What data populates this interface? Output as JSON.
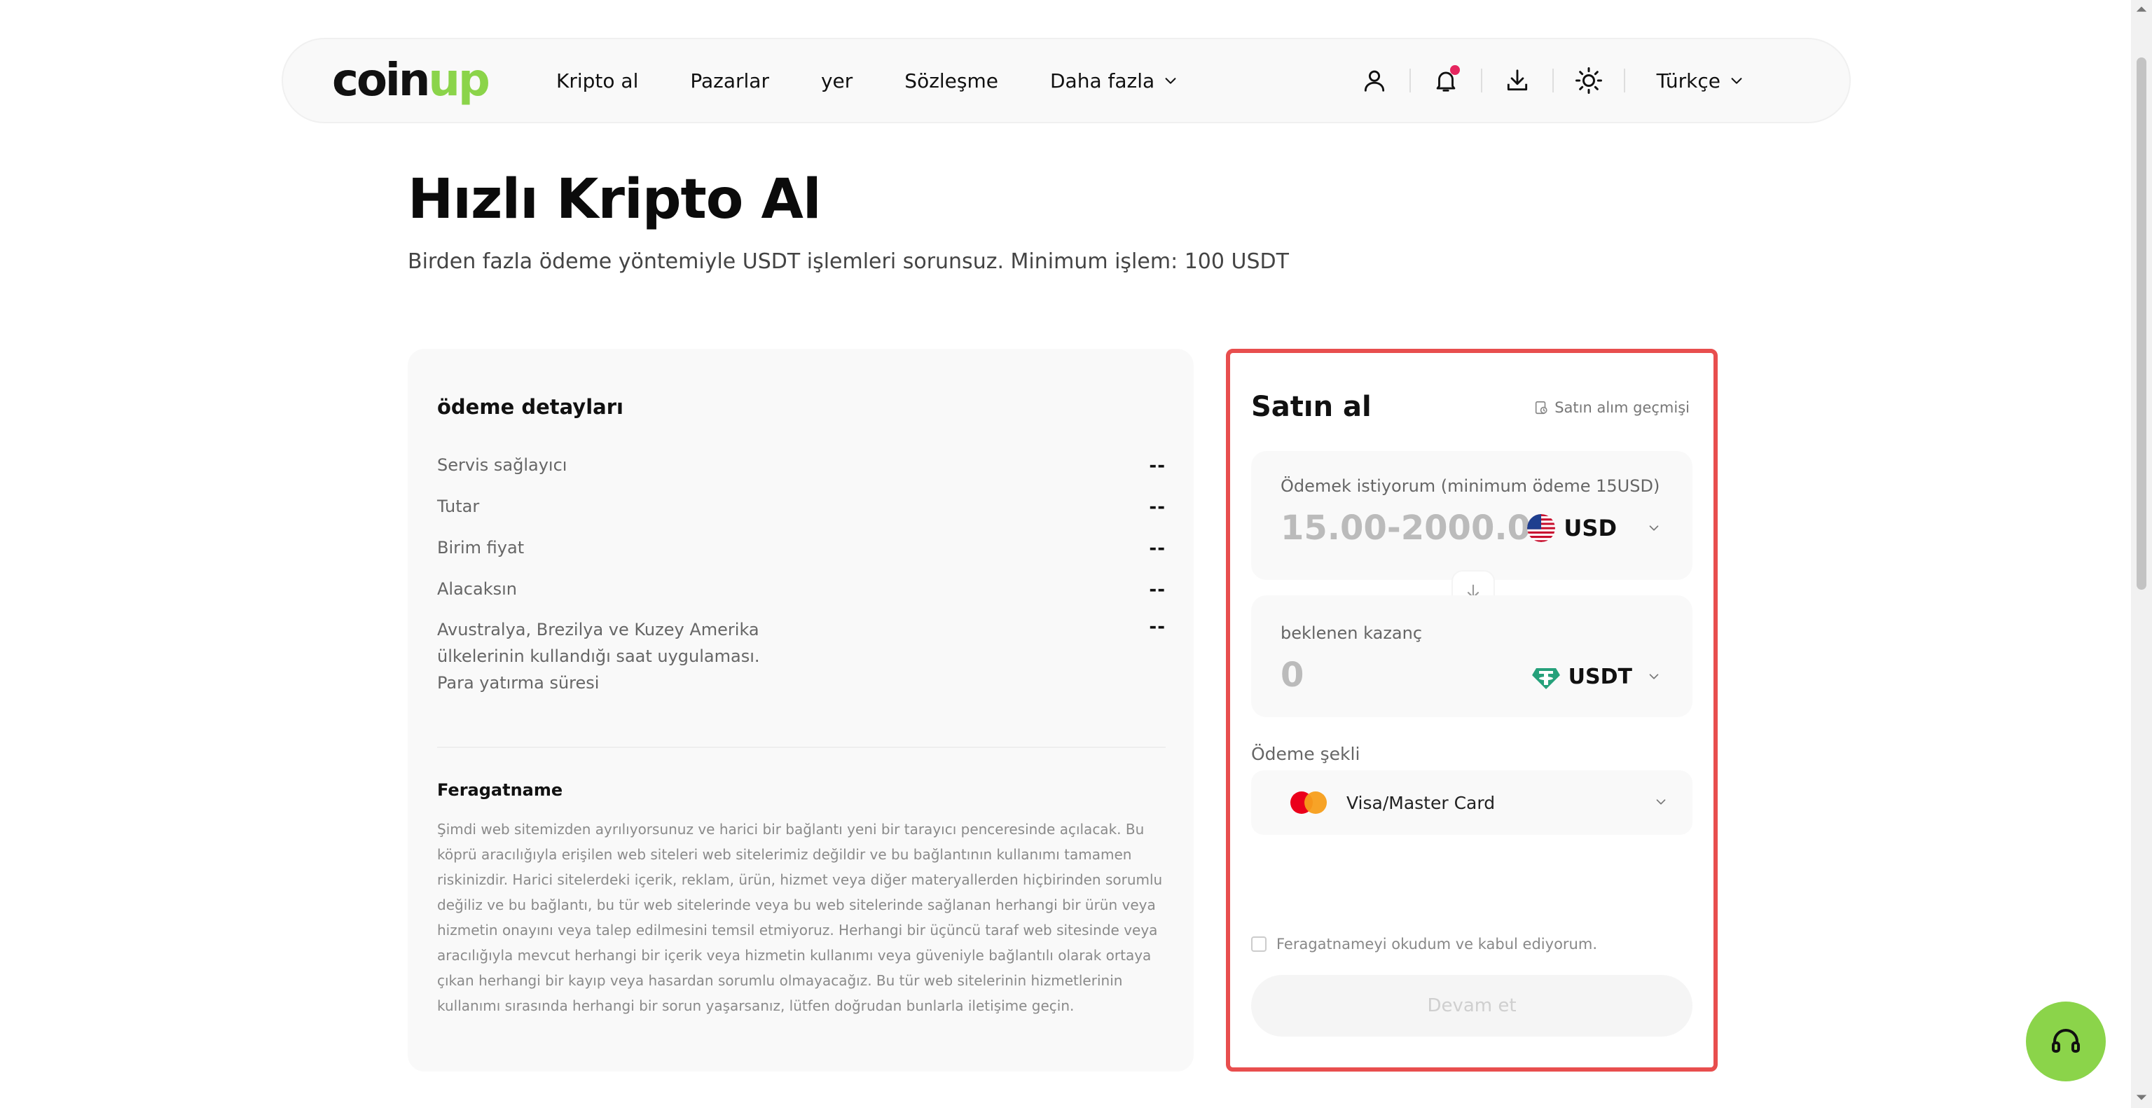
{
  "colors": {
    "brand": "#8bd44a",
    "highlight_border": "#e84e4e",
    "notification_dot": "#e5265f"
  },
  "nav": {
    "logo": {
      "part1": "coin",
      "part2": "up"
    },
    "links": [
      {
        "label": "Kripto al"
      },
      {
        "label": "Pazarlar"
      },
      {
        "label": "yer"
      },
      {
        "label": "Sözleşme"
      },
      {
        "label": "Daha fazla"
      }
    ],
    "icons": [
      "user-icon",
      "bell-icon",
      "download-icon",
      "sun-icon"
    ],
    "language": "Türkçe"
  },
  "header": {
    "title": "Hızlı Kripto Al",
    "subtitle": "Birden fazla ödeme yöntemiyle USDT işlemleri sorunsuz. Minimum işlem: 100 USDT"
  },
  "details": {
    "title": "ödeme detayları",
    "rows": [
      {
        "label": "Servis sağlayıcı",
        "value": "--"
      },
      {
        "label": "Tutar",
        "value": "--"
      },
      {
        "label": "Birim fiyat",
        "value": "--"
      },
      {
        "label": "Alacaksın",
        "value": "--"
      },
      {
        "label": "Avustralya, Brezilya ve Kuzey Amerika ülkelerinin kullandığı saat uygulaması. Para yatırma süresi",
        "value": "--"
      }
    ],
    "disclaimer_title": "Feragatname",
    "disclaimer_text": "Şimdi web sitemizden ayrılıyorsunuz ve harici bir bağlantı yeni bir tarayıcı penceresinde açılacak. Bu köprü aracılığıyla erişilen web siteleri web sitelerimiz değildir ve bu bağlantının kullanımı tamamen riskinizdir. Harici sitelerdeki içerik, reklam, ürün, hizmet veya diğer materyallerden hiçbirinden sorumlu değiliz ve bu bağlantı, bu tür web sitelerinde veya bu web sitelerinde sağlanan herhangi bir ürün veya hizmetin onayını veya talep edilmesini temsil etmiyoruz. Herhangi bir üçüncü taraf web sitesinde veya aracılığıyla mevcut herhangi bir içerik veya hizmetin kullanımı veya güveniyle bağlantılı olarak ortaya çıkan herhangi bir kayıp veya hasardan sorumlu olmayacağız. Bu tür web sitelerinin hizmetlerinin kullanımı sırasında herhangi bir sorun yaşarsanız, lütfen doğrudan bunlarla iletişime geçin."
  },
  "buy": {
    "title": "Satın al",
    "history_label": "Satın alım geçmişi",
    "pay": {
      "label": "Ödemek istiyorum (minimum ödeme 15USD)",
      "placeholder": "15.00-2000.00",
      "currency": "USD"
    },
    "receive": {
      "label": "beklenen kazanç",
      "value": "0",
      "currency": "USDT"
    },
    "payment_method_label": "Ödeme şekli",
    "payment_method": "Visa/Master Card",
    "agree_label": "Feragatnameyi okudum ve kabul ediyorum.",
    "continue_label": "Devam et"
  }
}
